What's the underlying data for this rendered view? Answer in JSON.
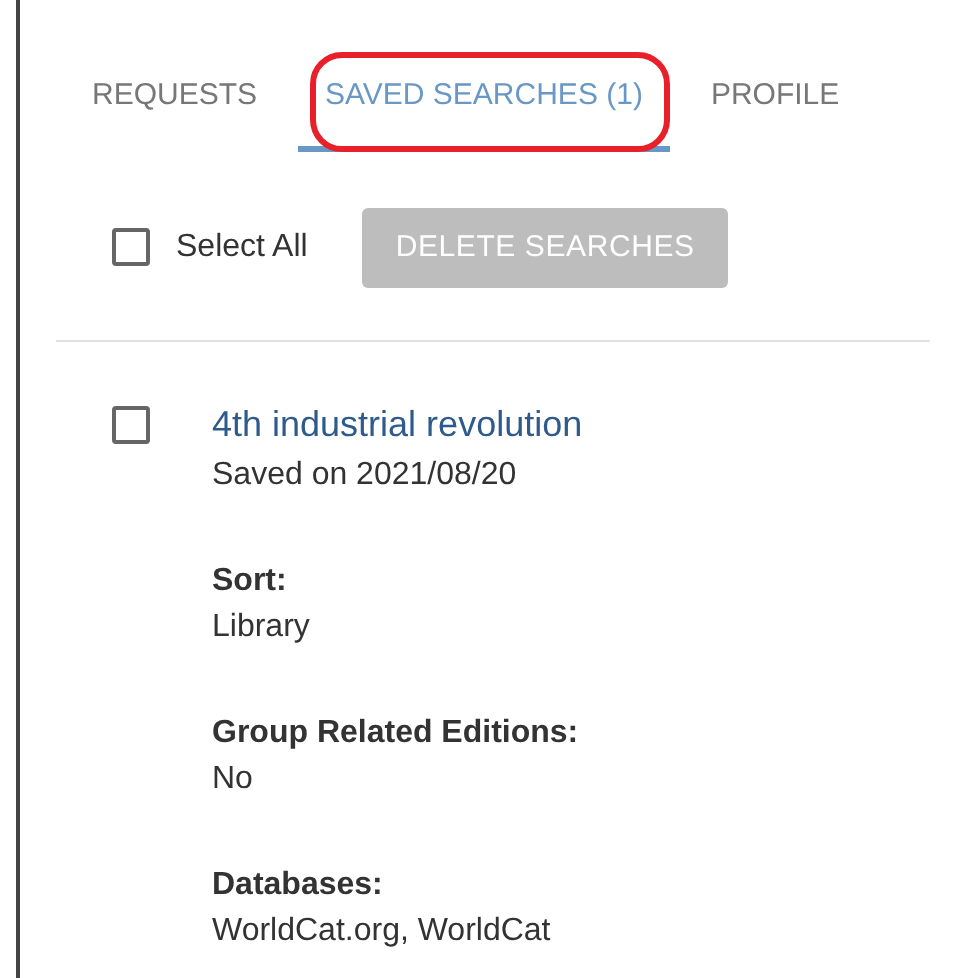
{
  "tabs": [
    {
      "label": "REQUESTS",
      "selected": false,
      "circled": false
    },
    {
      "label": "SAVED SEARCHES (1)",
      "selected": true,
      "circled": true
    },
    {
      "label": "PROFILE",
      "selected": false,
      "circled": false
    }
  ],
  "select_all": {
    "label": "Select All",
    "checked": false
  },
  "delete_button": {
    "label": "DELETE SEARCHES",
    "disabled": true
  },
  "saved_searches": [
    {
      "title": "4th industrial revolution",
      "checked": false,
      "saved": "Saved on 2021/08/20",
      "fields": [
        {
          "label": "Sort:",
          "value": "Library"
        },
        {
          "label": "Group Related Editions:",
          "value": "No"
        },
        {
          "label": "Databases:",
          "value": "WorldCat.org, WorldCat"
        }
      ]
    }
  ]
}
